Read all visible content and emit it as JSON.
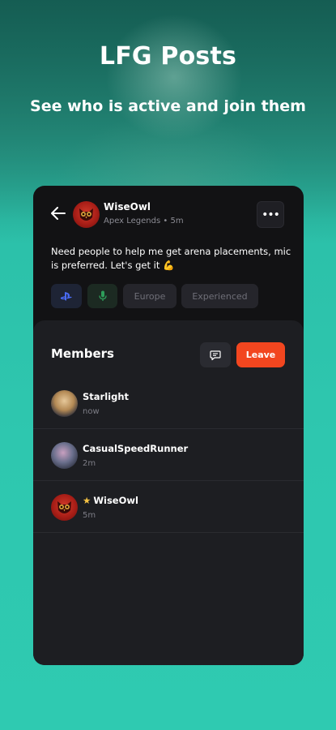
{
  "hero": {
    "title": "LFG Posts",
    "subtitle": "See who is active and join them"
  },
  "post": {
    "username": "WiseOwl",
    "meta": "Apex Legends • 5m",
    "body": "Need people to help me get arena placements, mic is preferred. Let's get it 💪",
    "tags": {
      "platform_icon": "playstation-icon",
      "mic_icon": "microphone-icon",
      "region": "Europe",
      "skill": "Experienced"
    }
  },
  "members": {
    "title": "Members",
    "leave_label": "Leave",
    "list": [
      {
        "name": "Starlight",
        "time": "now"
      },
      {
        "name": "CasualSpeedRunner",
        "time": "2m"
      },
      {
        "name": "WiseOwl",
        "time": "5m",
        "starred": true
      }
    ]
  },
  "colors": {
    "accent": "#f2461f",
    "background": "#2ec7af",
    "card": "#121214",
    "panel": "#1d1e22"
  }
}
